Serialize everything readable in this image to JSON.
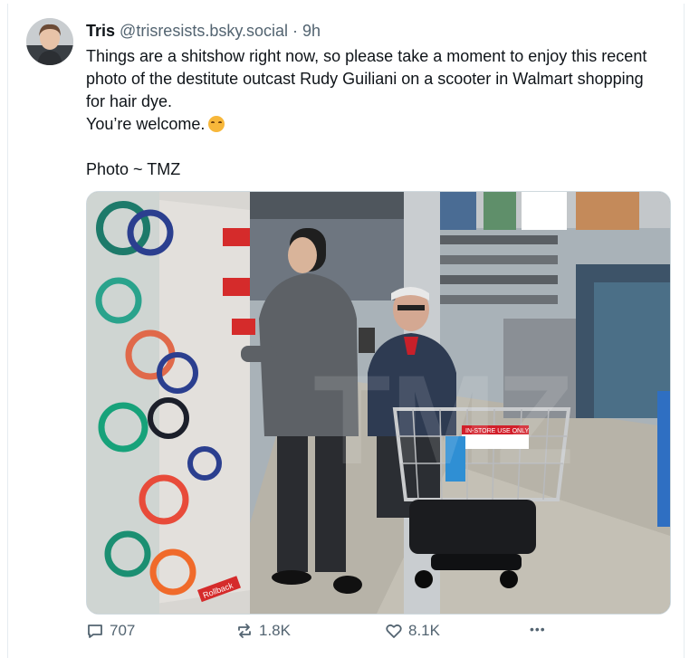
{
  "post": {
    "author_name": "Tris",
    "author_handle": "@trisresists.bsky.social",
    "separator": "·",
    "time": "9h",
    "text_line1": "Things are a shitshow right now, so please take a moment to enjoy this recent photo of the destitute outcast Rudy Guiliani on a scooter in Walmart shopping for hair dye.",
    "text_line2": "You’re welcome.",
    "text_line3": "Photo ~ TMZ",
    "emoji": "upside-down-face-emoji"
  },
  "photo": {
    "sign_text": "IN-STORE USE ONLY",
    "shelf_tag": "Rollback"
  },
  "actions": {
    "replies": "707",
    "reposts": "1.8K",
    "likes": "8.1K",
    "more": "•••"
  },
  "colors": {
    "text": "#0f1419",
    "muted": "#536471",
    "border": "#cfd9de"
  }
}
